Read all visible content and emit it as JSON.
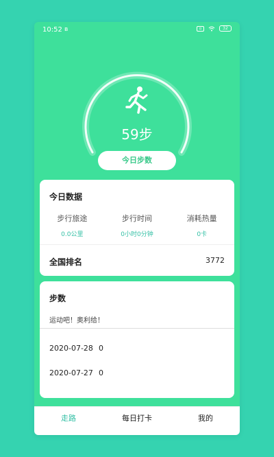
{
  "status": {
    "time": "10:52",
    "battery": "32"
  },
  "hero": {
    "steps_text": "59步",
    "today_button": "今日步数"
  },
  "today": {
    "title": "今日数据",
    "stats": [
      {
        "label": "步行旅途",
        "value": "0.0公里"
      },
      {
        "label": "步行时间",
        "value": "0小时0分钟"
      },
      {
        "label": "消耗热量",
        "value": "0卡"
      }
    ],
    "rank_label": "全国排名",
    "rank_value": "3772"
  },
  "steps_card": {
    "title": "步数",
    "motto": "运动吧！奥利给！",
    "records": [
      {
        "date": "2020-07-28",
        "count": "0"
      },
      {
        "date": "2020-07-27",
        "count": "0"
      }
    ]
  },
  "tabs": [
    {
      "label": "走路",
      "active": true
    },
    {
      "label": "每日打卡",
      "active": false
    },
    {
      "label": "我的",
      "active": false
    }
  ],
  "colors": {
    "accent": "#35c0a6",
    "hero_bg": "#3ee09b",
    "page_bg": "#35d3b0"
  }
}
